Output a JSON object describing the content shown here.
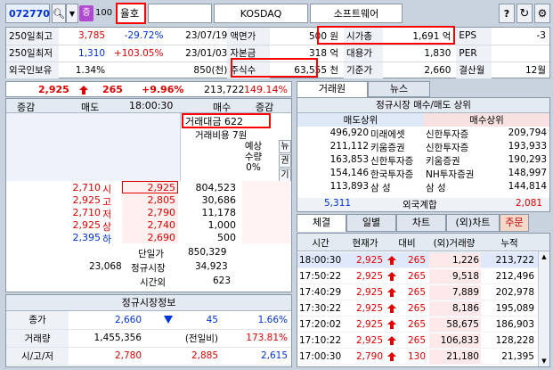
{
  "toolbar": {
    "code": "072770",
    "search_icon": "search-icon",
    "cnt": "100",
    "chk": "증",
    "name": "율호",
    "market": "KOSDAQ",
    "sector": "소프트웨어",
    "help": "?"
  },
  "info": [
    {
      "a": "250일최고",
      "b": "3,785",
      "c": "-29.72%",
      "d": "23/07/19",
      "e": "액면가",
      "f": "500 원",
      "g": "시가총",
      "h": "1,691 억",
      "i": "EPS",
      "j": "-3"
    },
    {
      "a": "250일최저",
      "b": "1,310",
      "c": "+103.05%",
      "d": "23/01/03",
      "e": "자본금",
      "f": "318 억",
      "g": "대용가",
      "h": "1,830",
      "i": "PER",
      "j": ""
    },
    {
      "a": "외국인보유",
      "b": "1.34%",
      "c": "",
      "d": "850(천)",
      "e": "주식수",
      "f": "63,555 천",
      "g": "기준가",
      "h": "2,660",
      "i": "결산월",
      "j": "12월"
    }
  ],
  "price": {
    "cur": "2,925",
    "diff": "265",
    "rate": "+9.96%",
    "vol": "213,722",
    "pct": "149.14%"
  },
  "ob": {
    "h1": "증감",
    "h2": "매도",
    "time": "18:00:30",
    "h3": "매수",
    "h4": "증감",
    "tv_label": "거래대금",
    "tv": "622",
    "tb_label": "거래비용",
    "tb": "7원",
    "exp_l1": "예상",
    "exp_l2": "수량",
    "exp_l3": "0%",
    "side": [
      "뉴",
      "권",
      "기"
    ],
    "levels": [
      {
        "n": "2,710",
        "t": "시",
        "p": "2,925",
        "v": "804,523",
        "hl": true
      },
      {
        "n": "2,925",
        "t": "고",
        "p": "2,805",
        "v": "30,686"
      },
      {
        "n": "2,710",
        "t": "저",
        "p": "2,790",
        "v": "11,178"
      },
      {
        "n": "2,925",
        "t": "상",
        "p": "2,740",
        "v": "1,000"
      },
      {
        "n": "2,395",
        "t": "하",
        "p": "2,690",
        "v": "500"
      }
    ],
    "single_l": "단일가",
    "single": "850,329",
    "sell_sum": "23,068",
    "reg_l": "정규시장",
    "reg": "34,923",
    "after_l": "시간외",
    "after": "623"
  },
  "reg": {
    "title": "정규시장정보",
    "rows": [
      {
        "k": "종가",
        "a": "2,660",
        "b": "45",
        "c": "1.66%"
      },
      {
        "k": "거래량",
        "a": "1,455,356",
        "b": "(전일비)",
        "c": "173.81%"
      },
      {
        "k": "시/고/저",
        "a": "2,780",
        "b": "2,885",
        "c": "2,615"
      }
    ]
  },
  "tabs1": [
    "거래원",
    "뉴스"
  ],
  "br": {
    "title": "정규시장 매수/매도 상위",
    "sell_h": "매도상위",
    "buy_h": "매수상위",
    "rows": [
      {
        "sv": "496,920",
        "sn": "미래에셋",
        "bn": "신한투자증",
        "bv": "209,794"
      },
      {
        "sv": "211,112",
        "sn": "키움증권",
        "bn": "신한투자증",
        "bv": "193,933"
      },
      {
        "sv": "163,853",
        "sn": "신한투자증",
        "bn": "키움증권",
        "bv": "190,293"
      },
      {
        "sv": "154,146",
        "sn": "한국투자증",
        "bn": "NH투자증권",
        "bv": "148,997"
      },
      {
        "sv": "113,893",
        "sn": "삼 성",
        "bn": "삼 성",
        "bv": "144,814"
      }
    ],
    "f_sell": "5,311",
    "f_label": "외국계합",
    "f_buy": "2,081"
  },
  "tabs2": [
    "체결",
    "일별",
    "차트",
    "(외)차트",
    "주문"
  ],
  "ticks": {
    "h": [
      "시간",
      "현재가",
      "대비",
      "(외)거래량",
      "누적"
    ],
    "rows": [
      {
        "t": "18:00:30",
        "p": "2,925",
        "d": "265",
        "v": "1,226",
        "c": "213,722",
        "sel": true
      },
      {
        "t": "17:50:22",
        "p": "2,925",
        "d": "265",
        "v": "9,518",
        "c": "212,496"
      },
      {
        "t": "17:40:29",
        "p": "2,925",
        "d": "265",
        "v": "7,889",
        "c": "202,978"
      },
      {
        "t": "17:30:22",
        "p": "2,925",
        "d": "265",
        "v": "8,186",
        "c": "195,089"
      },
      {
        "t": "17:20:02",
        "p": "2,925",
        "d": "265",
        "v": "58,675",
        "c": "186,903"
      },
      {
        "t": "17:10:22",
        "p": "2,925",
        "d": "265",
        "v": "106,833",
        "c": "128,228"
      },
      {
        "t": "17:00:30",
        "p": "2,790",
        "d": "130",
        "v": "21,180",
        "c": "21,395"
      }
    ]
  }
}
